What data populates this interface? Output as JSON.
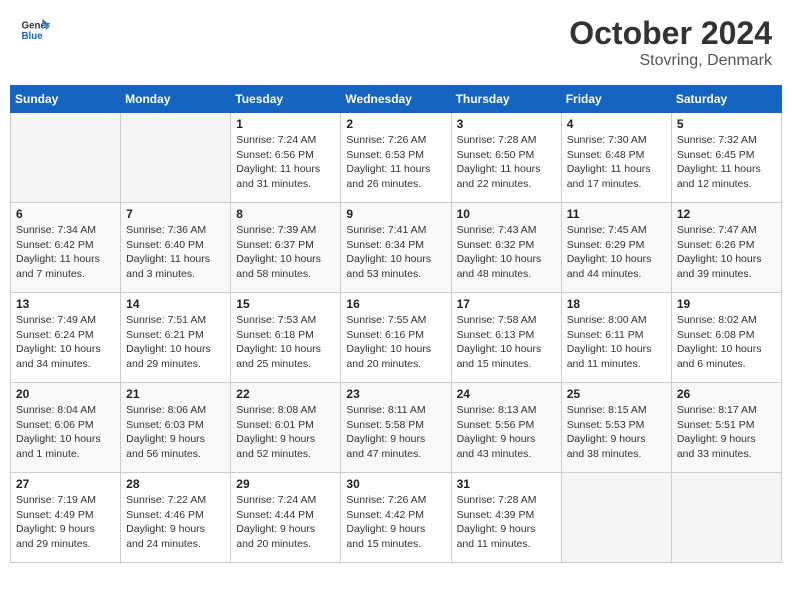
{
  "header": {
    "logo_general": "General",
    "logo_blue": "Blue",
    "month_title": "October 2024",
    "location": "Stovring, Denmark"
  },
  "weekdays": [
    "Sunday",
    "Monday",
    "Tuesday",
    "Wednesday",
    "Thursday",
    "Friday",
    "Saturday"
  ],
  "weeks": [
    [
      {
        "day": "",
        "info": ""
      },
      {
        "day": "",
        "info": ""
      },
      {
        "day": "1",
        "info": "Sunrise: 7:24 AM\nSunset: 6:56 PM\nDaylight: 11 hours and 31 minutes."
      },
      {
        "day": "2",
        "info": "Sunrise: 7:26 AM\nSunset: 6:53 PM\nDaylight: 11 hours and 26 minutes."
      },
      {
        "day": "3",
        "info": "Sunrise: 7:28 AM\nSunset: 6:50 PM\nDaylight: 11 hours and 22 minutes."
      },
      {
        "day": "4",
        "info": "Sunrise: 7:30 AM\nSunset: 6:48 PM\nDaylight: 11 hours and 17 minutes."
      },
      {
        "day": "5",
        "info": "Sunrise: 7:32 AM\nSunset: 6:45 PM\nDaylight: 11 hours and 12 minutes."
      }
    ],
    [
      {
        "day": "6",
        "info": "Sunrise: 7:34 AM\nSunset: 6:42 PM\nDaylight: 11 hours and 7 minutes."
      },
      {
        "day": "7",
        "info": "Sunrise: 7:36 AM\nSunset: 6:40 PM\nDaylight: 11 hours and 3 minutes."
      },
      {
        "day": "8",
        "info": "Sunrise: 7:39 AM\nSunset: 6:37 PM\nDaylight: 10 hours and 58 minutes."
      },
      {
        "day": "9",
        "info": "Sunrise: 7:41 AM\nSunset: 6:34 PM\nDaylight: 10 hours and 53 minutes."
      },
      {
        "day": "10",
        "info": "Sunrise: 7:43 AM\nSunset: 6:32 PM\nDaylight: 10 hours and 48 minutes."
      },
      {
        "day": "11",
        "info": "Sunrise: 7:45 AM\nSunset: 6:29 PM\nDaylight: 10 hours and 44 minutes."
      },
      {
        "day": "12",
        "info": "Sunrise: 7:47 AM\nSunset: 6:26 PM\nDaylight: 10 hours and 39 minutes."
      }
    ],
    [
      {
        "day": "13",
        "info": "Sunrise: 7:49 AM\nSunset: 6:24 PM\nDaylight: 10 hours and 34 minutes."
      },
      {
        "day": "14",
        "info": "Sunrise: 7:51 AM\nSunset: 6:21 PM\nDaylight: 10 hours and 29 minutes."
      },
      {
        "day": "15",
        "info": "Sunrise: 7:53 AM\nSunset: 6:18 PM\nDaylight: 10 hours and 25 minutes."
      },
      {
        "day": "16",
        "info": "Sunrise: 7:55 AM\nSunset: 6:16 PM\nDaylight: 10 hours and 20 minutes."
      },
      {
        "day": "17",
        "info": "Sunrise: 7:58 AM\nSunset: 6:13 PM\nDaylight: 10 hours and 15 minutes."
      },
      {
        "day": "18",
        "info": "Sunrise: 8:00 AM\nSunset: 6:11 PM\nDaylight: 10 hours and 11 minutes."
      },
      {
        "day": "19",
        "info": "Sunrise: 8:02 AM\nSunset: 6:08 PM\nDaylight: 10 hours and 6 minutes."
      }
    ],
    [
      {
        "day": "20",
        "info": "Sunrise: 8:04 AM\nSunset: 6:06 PM\nDaylight: 10 hours and 1 minute."
      },
      {
        "day": "21",
        "info": "Sunrise: 8:06 AM\nSunset: 6:03 PM\nDaylight: 9 hours and 56 minutes."
      },
      {
        "day": "22",
        "info": "Sunrise: 8:08 AM\nSunset: 6:01 PM\nDaylight: 9 hours and 52 minutes."
      },
      {
        "day": "23",
        "info": "Sunrise: 8:11 AM\nSunset: 5:58 PM\nDaylight: 9 hours and 47 minutes."
      },
      {
        "day": "24",
        "info": "Sunrise: 8:13 AM\nSunset: 5:56 PM\nDaylight: 9 hours and 43 minutes."
      },
      {
        "day": "25",
        "info": "Sunrise: 8:15 AM\nSunset: 5:53 PM\nDaylight: 9 hours and 38 minutes."
      },
      {
        "day": "26",
        "info": "Sunrise: 8:17 AM\nSunset: 5:51 PM\nDaylight: 9 hours and 33 minutes."
      }
    ],
    [
      {
        "day": "27",
        "info": "Sunrise: 7:19 AM\nSunset: 4:49 PM\nDaylight: 9 hours and 29 minutes."
      },
      {
        "day": "28",
        "info": "Sunrise: 7:22 AM\nSunset: 4:46 PM\nDaylight: 9 hours and 24 minutes."
      },
      {
        "day": "29",
        "info": "Sunrise: 7:24 AM\nSunset: 4:44 PM\nDaylight: 9 hours and 20 minutes."
      },
      {
        "day": "30",
        "info": "Sunrise: 7:26 AM\nSunset: 4:42 PM\nDaylight: 9 hours and 15 minutes."
      },
      {
        "day": "31",
        "info": "Sunrise: 7:28 AM\nSunset: 4:39 PM\nDaylight: 9 hours and 11 minutes."
      },
      {
        "day": "",
        "info": ""
      },
      {
        "day": "",
        "info": ""
      }
    ]
  ]
}
